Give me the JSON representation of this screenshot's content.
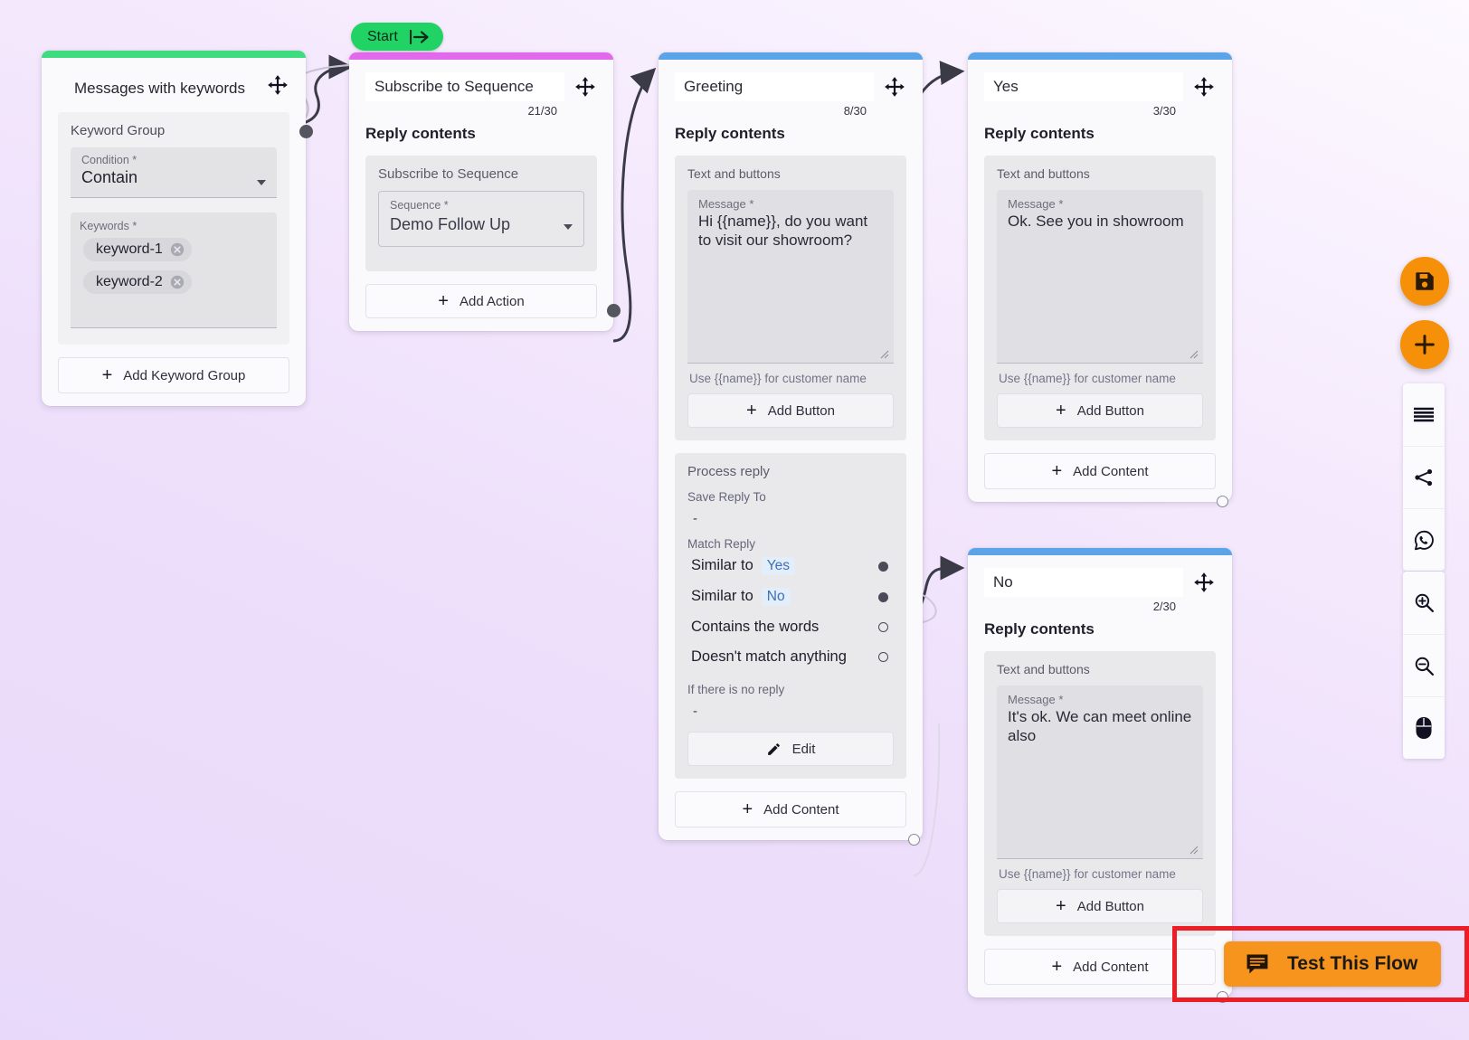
{
  "canvas": {
    "start_badge": {
      "label": "Start",
      "icon": "start-arrow-icon"
    },
    "accent_colors": {
      "keyword_card_bar": "#3ddc7f",
      "sequence_card_bar": "#e269ec",
      "message_card_bar": "#5ba4e8",
      "orange_fab": "#f79009",
      "test_button": "#f7941d",
      "highlight_border": "#ee1c25"
    }
  },
  "cards": {
    "keywords": {
      "title": "Messages with keywords",
      "group_label": "Keyword Group",
      "condition": {
        "label": "Condition *",
        "value": "Contain"
      },
      "keywords": {
        "label": "Keywords *",
        "items": [
          "keyword-1",
          "keyword-2"
        ]
      },
      "add_group_button": "Add Keyword Group"
    },
    "sequence": {
      "title": "Subscribe to Sequence",
      "char_count": "21/30",
      "section": "Reply contents",
      "panel_label": "Subscribe to Sequence",
      "sequence_field": {
        "label": "Sequence *",
        "value": "Demo Follow Up"
      },
      "add_action_button": "Add Action"
    },
    "greeting": {
      "title": "Greeting",
      "char_count": "8/30",
      "section": "Reply contents",
      "panel_label": "Text and buttons",
      "message": {
        "label": "Message *",
        "value": "Hi {{name}}, do you want to visit our showroom?"
      },
      "hint": "Use {{name}} for customer name",
      "add_button": "Add Button",
      "process_reply": {
        "title": "Process reply",
        "save_reply_to_label": "Save Reply To",
        "save_reply_to_value": "-",
        "match_reply_label": "Match Reply",
        "rules": [
          {
            "text": "Similar to",
            "value": "Yes",
            "state": "filled"
          },
          {
            "text": "Similar to",
            "value": "No",
            "state": "filled"
          },
          {
            "text": "Contains the words",
            "value": "",
            "state": "empty"
          },
          {
            "text": "Doesn't match anything",
            "value": "",
            "state": "empty"
          }
        ],
        "no_reply_label": "If there is no reply",
        "no_reply_value": "-",
        "edit_button": "Edit"
      },
      "add_content_button": "Add Content"
    },
    "yes": {
      "title": "Yes",
      "char_count": "3/30",
      "section": "Reply contents",
      "panel_label": "Text and buttons",
      "message": {
        "label": "Message *",
        "value": "Ok. See you in showroom"
      },
      "hint": "Use {{name}} for customer name",
      "add_button": "Add Button",
      "add_content_button": "Add Content"
    },
    "no": {
      "title": "No",
      "char_count": "2/30",
      "section": "Reply contents",
      "panel_label": "Text and buttons",
      "message": {
        "label": "Message *",
        "value": "It's ok. We can meet online also"
      },
      "hint": "Use {{name}} for customer name",
      "add_button": "Add Button",
      "add_content_button": "Add Content"
    }
  },
  "toolbar": {
    "save": "save-icon",
    "add": "plus-icon",
    "menu": "hamburger-menu-icon",
    "share": "share-icon",
    "whatsapp": "whatsapp-icon",
    "zoom_in": "zoom-in-icon",
    "zoom_out": "zoom-out-icon",
    "mouse": "mouse-icon"
  },
  "test_flow": {
    "label": "Test This Flow",
    "icon": "chat-bubble-icon"
  }
}
